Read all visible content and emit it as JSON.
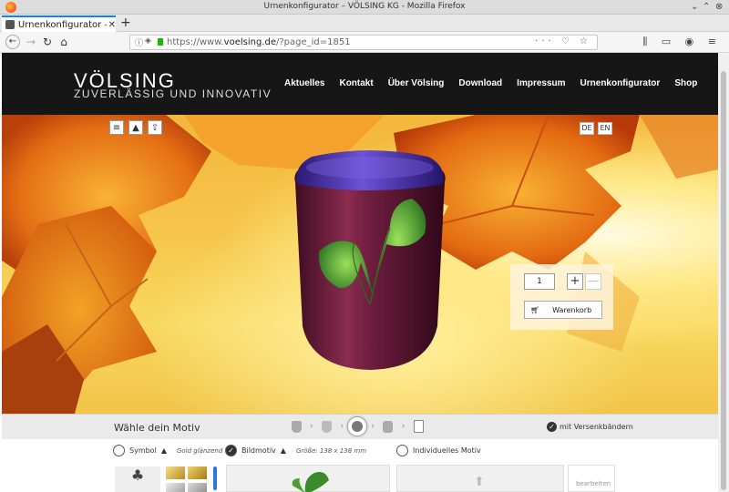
{
  "browser": {
    "window_title": "Urnenkonfigurator – VÖLSING KG - Mozilla Firefox",
    "tab_label": "Urnenkonfigurator –",
    "url_prefix": "https://www.",
    "url_domain": "voelsing.de",
    "url_path": "/?page_id=1851"
  },
  "site": {
    "logo": "VÖLSING",
    "tagline": "ZUVERLÄSSIG UND INNOVATIV",
    "nav": [
      "Aktuelles",
      "Kontakt",
      "Über Völsing",
      "Download",
      "Impressum",
      "Urnenkonfigurator",
      "Shop"
    ]
  },
  "configurator": {
    "lang_de": "DE",
    "lang_en": "EN",
    "quantity": "1",
    "plus": "+",
    "minus": "—",
    "cart_label": "Warenkorb",
    "step_title": "Wähle dein Motiv",
    "bands_label": "mit Versenkbändern",
    "options": {
      "symbol": "Symbol",
      "symbol_sub": "Gold glänzend",
      "bild": "Bildmotiv",
      "bild_sub": "Größe: 138 x 138 mm",
      "individuell": "Individuelles Motiv",
      "edit": "bearbeiten"
    }
  },
  "colors": {
    "urn_body": "#6b1d3c",
    "urn_lid": "#4b2ea0",
    "header_bg": "#161616"
  }
}
